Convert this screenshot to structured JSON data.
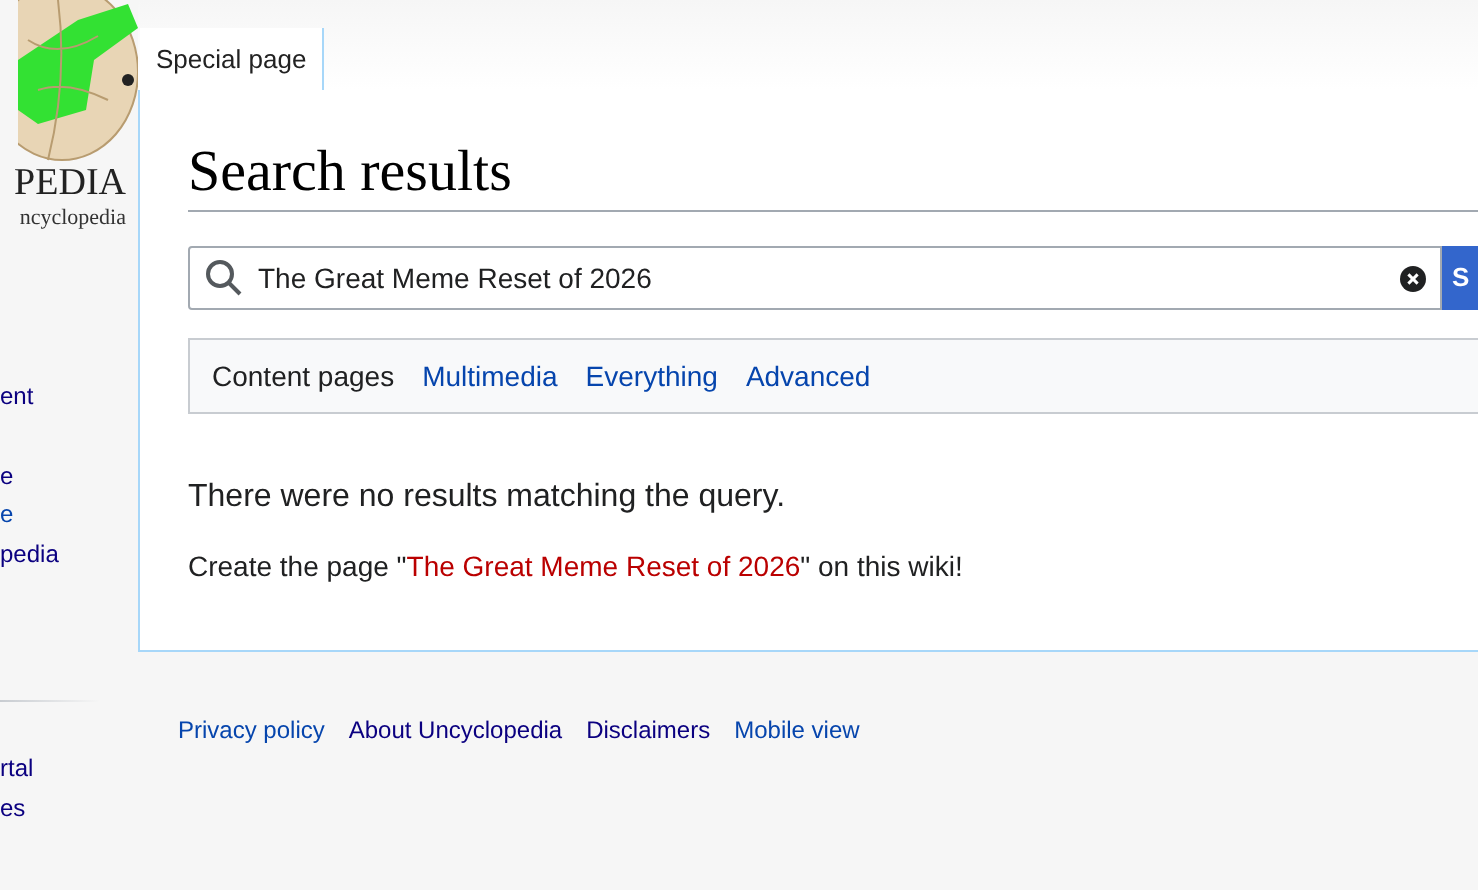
{
  "logo": {
    "wordmark": "PEDIA",
    "tagline": "ncyclopedia"
  },
  "sidebar": {
    "groups": [
      {
        "items": [
          {
            "label": "ent",
            "kind": "visited"
          }
        ]
      },
      {
        "items": [
          {
            "label": "e",
            "kind": "visited"
          },
          {
            "label": "e",
            "kind": "link"
          },
          {
            "label": "pedia",
            "kind": "visited"
          }
        ]
      },
      {
        "divider": true,
        "items": [
          {
            "label": "rtal",
            "kind": "visited"
          },
          {
            "label": "es",
            "kind": "visited"
          }
        ]
      }
    ]
  },
  "page_tabs": [
    {
      "label": "Special page",
      "selected": true
    }
  ],
  "heading": "Search results",
  "search": {
    "value": "The Great Meme Reset of 2026",
    "button": "S"
  },
  "search_tabs": [
    {
      "label": "Content pages",
      "selected": true
    },
    {
      "label": "Multimedia",
      "selected": false
    },
    {
      "label": "Everything",
      "selected": false
    },
    {
      "label": "Advanced",
      "selected": false
    }
  ],
  "message": "There were no results matching the query.",
  "create": {
    "before": "Create the page \"",
    "link": "The Great Meme Reset of 2026",
    "after": "\" on this wiki!"
  },
  "footer": [
    {
      "label": "Privacy policy",
      "kind": "link"
    },
    {
      "label": "About Uncyclopedia",
      "kind": "visited"
    },
    {
      "label": "Disclaimers",
      "kind": "visited"
    },
    {
      "label": "Mobile view",
      "kind": "link"
    }
  ]
}
